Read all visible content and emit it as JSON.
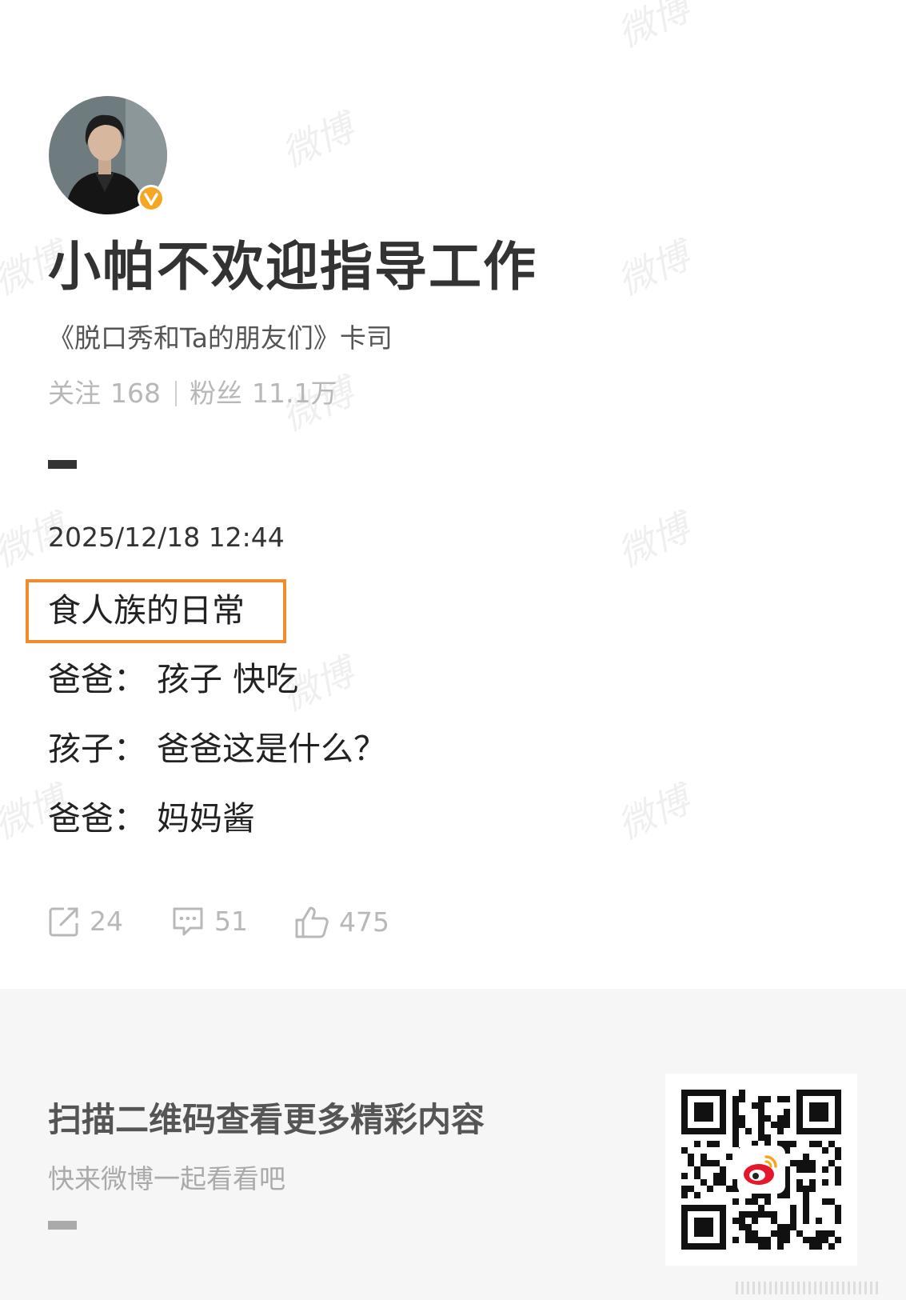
{
  "watermark": "微博",
  "profile": {
    "name": "小帕不欢迎指导工作",
    "description": "《脱口秀和Ta的朋友们》卡司",
    "following_label": "关注",
    "following_count": "168",
    "followers_label": "粉丝",
    "followers_count": "11.1万",
    "verified_badge_color": "#f5a623"
  },
  "post": {
    "timestamp": "2025/12/18 12:44",
    "title": "食人族的日常",
    "lines": [
      "爸爸：  孩子 快吃",
      "孩子：  爸爸这是什么？",
      "爸爸：  妈妈酱"
    ],
    "highlight_color": "#f28b2a"
  },
  "actions": {
    "repost_count": "24",
    "comment_count": "51",
    "like_count": "475"
  },
  "footer": {
    "title": "扫描二维码查看更多精彩内容",
    "subtitle": "快来微博一起看看吧"
  },
  "icons": [
    "verified-icon",
    "repost-icon",
    "comment-icon",
    "like-icon",
    "qr-code-icon",
    "weibo-logo-icon"
  ]
}
